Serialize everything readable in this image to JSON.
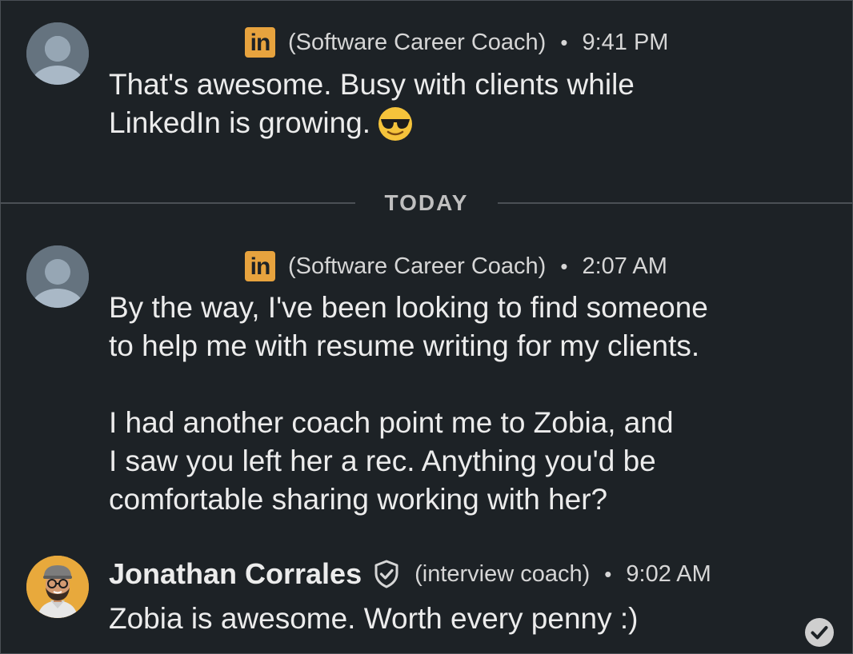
{
  "messages": [
    {
      "sender_meta": "(Software Career Coach)",
      "time": "9:41 PM",
      "network_logo": "in",
      "lines": [
        "That's awesome. Busy with clients while",
        "LinkedIn is growing."
      ],
      "emoji": "smiling-face-with-sunglasses"
    },
    {
      "sender_meta": "(Software Career Coach)",
      "time": "2:07 AM",
      "network_logo": "in",
      "paragraphs": [
        [
          "By the way, I've been looking to find someone",
          "to help me with resume writing for my clients."
        ],
        [
          "I had another coach point me to Zobia, and",
          "I saw you left her a rec. Anything you'd be",
          "comfortable sharing working with her?"
        ]
      ]
    },
    {
      "sender_name": "Jonathan Corrales",
      "sender_meta": "(interview coach)",
      "time": "9:02 AM",
      "text": "Zobia is awesome. Worth every penny :)"
    }
  ],
  "divider": {
    "label": "TODAY"
  },
  "separator": "•",
  "colors": {
    "background": "#1d2226",
    "text": "#ececec",
    "linkedin_logo": "#e7a33e",
    "avatar_placeholder": "#65737f",
    "coach_avatar_bg": "#e8a93c"
  }
}
